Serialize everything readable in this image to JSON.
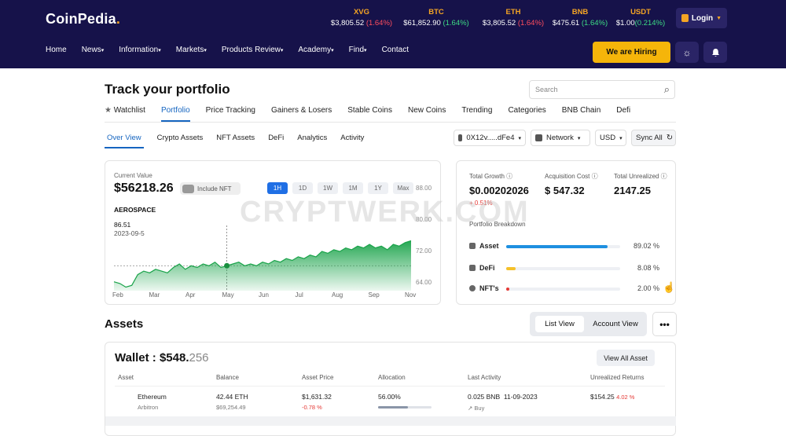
{
  "brand": {
    "logo_text": "CoinPedia",
    "logo_dot": "."
  },
  "tickers": [
    {
      "symbol": "XVG",
      "price": "$3,805.52",
      "change": "(1.64%)",
      "dir": "neg"
    },
    {
      "symbol": "BTC",
      "price": "$61,852.90",
      "change": "(1.64%)",
      "dir": "pos"
    },
    {
      "symbol": "ETH",
      "price": "$3,805.52",
      "change": "(1.64%)",
      "dir": "neg"
    },
    {
      "symbol": "BNB",
      "price": "$475.61",
      "change": "(1.64%)",
      "dir": "pos"
    },
    {
      "symbol": "USDT",
      "price": "$1.00",
      "change": "(0.214%)",
      "dir": "pos"
    }
  ],
  "login_label": "Login",
  "nav": [
    "Home",
    "News",
    "Information",
    "Markets",
    "Products Review",
    "Academy",
    "Find",
    "Contact"
  ],
  "hiring_label": "We are Hiring",
  "page_title": "Track your portfolio",
  "search_placeholder": "Search",
  "main_tabs": [
    "Watchlist",
    "Portfolio",
    "Price Tracking",
    "Gainers & Losers",
    "Stable Coins",
    "New Coins",
    "Trending",
    "Categories",
    "BNB Chain",
    "Defi"
  ],
  "sub_tabs": [
    "Over View",
    "Crypto Assets",
    "NFT Assets",
    "DeFi",
    "Analytics",
    "Activity"
  ],
  "wallet_select": "0X12v.....dFe4",
  "network_select": "Network",
  "currency_select": "USD",
  "sync_label": "Sync All",
  "overview": {
    "current_value_label": "Current Value",
    "current_value": "$56218.26",
    "include_nft_label": "Include NFT",
    "ranges": [
      "1H",
      "1D",
      "1W",
      "1M",
      "1Y",
      "Max"
    ],
    "asset_name": "AEROSPACE",
    "point_value": "86.51",
    "point_date": "2023-09-5"
  },
  "chart_data": {
    "type": "area",
    "x_ticks": [
      "Feb",
      "Mar",
      "Apr",
      "May",
      "Jun",
      "Jul",
      "Aug",
      "Sep",
      "Nov"
    ],
    "y_ticks": [
      "88.00",
      "80.00",
      "72.00",
      "64.00"
    ],
    "ylim": [
      60,
      90
    ],
    "values": [
      65,
      64,
      62,
      63,
      69,
      71,
      70,
      72,
      71,
      70,
      73,
      75,
      72,
      74,
      73,
      75,
      74,
      76,
      73,
      74,
      75,
      76,
      74,
      75,
      74,
      76,
      75,
      77,
      76,
      78,
      77,
      79,
      78,
      80,
      79,
      82,
      81,
      83,
      82,
      84,
      83,
      85,
      84,
      86,
      84,
      85,
      83,
      86,
      85,
      87,
      88
    ],
    "highlight_index": 19,
    "color": "#1aa34a"
  },
  "stats": {
    "total_growth_label": "Total Growth",
    "total_growth": "$0.00202026",
    "growth_change": "+ 0.51%",
    "acq_cost_label": "Acquisition Cost",
    "acq_cost": "$ 547.32",
    "unrealized_label": "Total Unrealized",
    "unrealized": "2147.25",
    "breakdown_label": "Portfolio Breakdown"
  },
  "breakdown": [
    {
      "name": "Asset",
      "pct": "89.02 %",
      "level": 0.8902,
      "color": "#1e90e0"
    },
    {
      "name": "DeFi",
      "pct": "8.08 %",
      "level": 0.0808,
      "color": "#f5c12a"
    },
    {
      "name": "NFT's",
      "pct": "2.00 %",
      "level": 0.02,
      "color": "#e53935"
    }
  ],
  "assets_title": "Assets",
  "list_view_label": "List View",
  "account_view_label": "Account View",
  "more_label": "•••",
  "wallet_label": "Wallet : $548.",
  "wallet_decimal": "256",
  "view_all_label": "View All Asset",
  "table": {
    "headers": [
      "Asset",
      "Balance",
      "Asset Price",
      "Allocation",
      "Last Activity",
      "Unrealized Returns"
    ],
    "row": {
      "name": "Ethereum",
      "chain": "Arbitron",
      "balance": "42.44 ETH",
      "balance_usd": "$69,254.49",
      "price": "$1,631.32",
      "price_change": "-0.78 %",
      "allocation": "56.00%",
      "allocation_level": 0.56,
      "activity": "0.025 BNB",
      "activity_date": "11-09-2023",
      "activity_type": "Buy",
      "returns": "$154.25",
      "returns_change": "4.02 %"
    }
  },
  "watermark": "CRYPTWERK.COM"
}
